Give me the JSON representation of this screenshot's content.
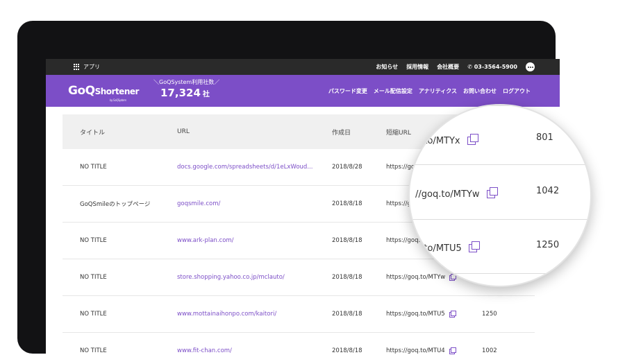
{
  "topbar": {
    "apps_label": "アプリ",
    "links": [
      "お知らせ",
      "採用情報",
      "会社概要",
      "03-3564-5900"
    ]
  },
  "header": {
    "logo_main": "GoQ",
    "logo_sub": "Shortener",
    "logo_tag": "by GoQSystem",
    "stats_label": "＼GoQSystem利用社数／",
    "stats_value": "17,324",
    "stats_unit": "社",
    "nav": [
      "パスワード変更",
      "メール配信設定",
      "アナリティクス",
      "お問い合わせ",
      "ログアウト"
    ]
  },
  "table": {
    "headers": [
      "タイトル",
      "URL",
      "作成日",
      "短縮URL"
    ],
    "rows": [
      {
        "title": "NO TITLE",
        "url": "docs.google.com/spreadsheets/d/1eLxWoud...",
        "date": "2018/8/28",
        "short": "https://goq.to/MTYx",
        "clicks": "801"
      },
      {
        "title": "GoQSmileのトップページ",
        "url": "goqsmile.com/",
        "date": "2018/8/18",
        "short": "https://goq.to/MTYw",
        "clicks": "1042"
      },
      {
        "title": "NO TITLE",
        "url": "www.ark-plan.com/",
        "date": "2018/8/18",
        "short": "https://goq.to/MTU5",
        "clicks": "1250"
      },
      {
        "title": "NO TITLE",
        "url": "store.shopping.yahoo.co.jp/mclauto/",
        "date": "2018/8/18",
        "short": "https://goq.to/MTYw",
        "clicks": ""
      },
      {
        "title": "NO TITLE",
        "url": "www.mottainaihonpo.com/kaitori/",
        "date": "2018/8/18",
        "short": "https://goq.to/MTU5",
        "clicks": "1250"
      },
      {
        "title": "NO TITLE",
        "url": "www.fit-chan.com/",
        "date": "2018/8/18",
        "short": "https://goq.to/MTU4",
        "clicks": "1002"
      }
    ]
  },
  "magnifier": [
    {
      "short": "q.to/MTYx",
      "clicks": "801"
    },
    {
      "short": "//goq.to/MTYw",
      "clicks": "1042"
    },
    {
      "short": "q.to/MTU5",
      "clicks": "1250"
    }
  ],
  "colors": {
    "brand": "#7c4ec7",
    "topbar": "#2a2a2a",
    "frame": "#121214"
  }
}
